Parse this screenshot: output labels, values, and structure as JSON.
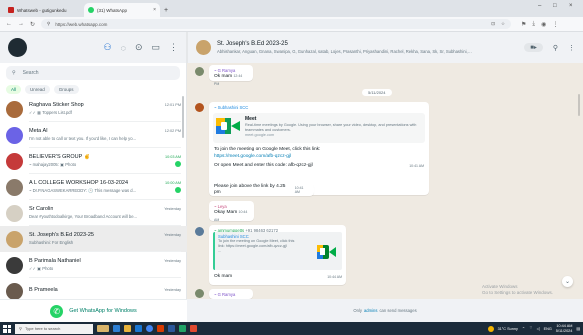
{
  "browser": {
    "tabs": [
      {
        "label": "Whatsweb - gutigunkedu",
        "color": "#c5221f"
      },
      {
        "label": "(31) WhatsApp",
        "color": "#25d366",
        "close": "×"
      }
    ],
    "newtab": "+",
    "url": "https://web.whatsapp.com",
    "window_controls": [
      "–",
      "□",
      "×"
    ]
  },
  "left": {
    "search_placeholder": "Search",
    "filters": [
      "All",
      "Unread",
      "Groups"
    ],
    "chats": [
      {
        "name": "Raghava Sticker Shop",
        "preview": "✓✓ ▦ Toppers List.pdf",
        "time": "12:01 PM",
        "avatar": "#a96b3c",
        "unread": false,
        "selected": false
      },
      {
        "name": "Meta AI",
        "preview": "I'm not able to call or text you. If you'd like, I can help yo...",
        "time": "12:02 PM",
        "avatar": "#6b63e6",
        "unread": false,
        "selected": false
      },
      {
        "name": "BELIEVER'S GROUP ✌",
        "preview": "~ mahajay2005: ▣ Photo",
        "time": "10:03 AM",
        "avatar": "#c53a3a",
        "unread": true,
        "selected": false
      },
      {
        "name": "A L COLLEGE WORKSHOP 16-03-2024",
        "preview": "~ Dr.P.NAGASWEKARREDDY: 🕓 This message was d...",
        "time": "10:00 AM",
        "avatar": "#8a7a6a",
        "unread": true,
        "selected": false
      },
      {
        "name": "Sr Carolin",
        "preview": "Dear #youthtodoalkirge, Your Broadband Account will be...",
        "time": "Yesterday",
        "avatar": "#d6d0c4",
        "unread": false,
        "selected": false
      },
      {
        "name": "St. Joseph's B.Ed 2023-25",
        "preview": "Subhashini: For English",
        "time": "Yesterday",
        "avatar": "#c9a36b",
        "unread": false,
        "selected": true
      },
      {
        "name": "B Parimala Nathaniel",
        "preview": "✓✓ ▣ Photo",
        "time": "Yesterday",
        "avatar": "#3a3a3a",
        "unread": false,
        "selected": false
      },
      {
        "name": "B Prameela",
        "preview": "",
        "time": "Yesterday",
        "avatar": "#6a5b4e",
        "unread": false,
        "selected": false
      }
    ],
    "promo": "Get WhatsApp for Windows"
  },
  "right": {
    "group_name": "St. Joseph's B.Ed 2023-25",
    "members": "Abhishankar, Anguan, Gnana, Swanipa, G, Gunhazal, satab, Lojes, Prasanthi, Priyashandini, Rachel, Rekha, Sana, Sk, Sr, Subhashini, Sushantha...",
    "date_chip": "5/11/2024",
    "msg1": {
      "sender": "~ G Ramya",
      "text": "Ok mam",
      "time": "12:44 PM"
    },
    "msg2": {
      "sender": "~ Subhashini SCC",
      "preview_title": "Meet",
      "preview_desc": "Real-time meetings by Google. Using your browser, share your video, desktop, and presentations with teammates and customers.",
      "preview_domain": "meet.google.com",
      "line1": "To join the meeting on Google Meet, click this link:",
      "link": "https://meet.google.com/afb-qzcz-gjl",
      "line2": "Or open Meet and enter this code: afb-qzcz-gjl",
      "time1": "10:41 AM",
      "line3": "Please join above the link by 4.25 pm",
      "time2": "10:41 AM"
    },
    "msg3": {
      "sender": "~ Leya",
      "text": "Okay Mam",
      "time": "10:44 AM"
    },
    "msg4": {
      "sender": "~ ammumpgetts",
      "sender_phone": "+91 98463 62172",
      "quote_sender": "Subhashini SCC",
      "quote_text": "To join the meeting on Google Meet, click this link: https://meet.google.com/afb-qzcz-gjl",
      "quote_ellipsis": "...",
      "text": "Ok mam",
      "time": "10:44 AM"
    },
    "msg5_sender": "~ G Ramya",
    "footer_pre": "Only",
    "footer_admin": "admins",
    "footer_post": "can send messages",
    "activate_title": "Activate Windows",
    "activate_sub": "Go to Settings to activate Windows."
  },
  "taskbar": {
    "search": "Type here to search",
    "weather": "31°C Sunny",
    "lang": "ENG",
    "time": "10:44 AM",
    "date": "5/11/2024"
  }
}
